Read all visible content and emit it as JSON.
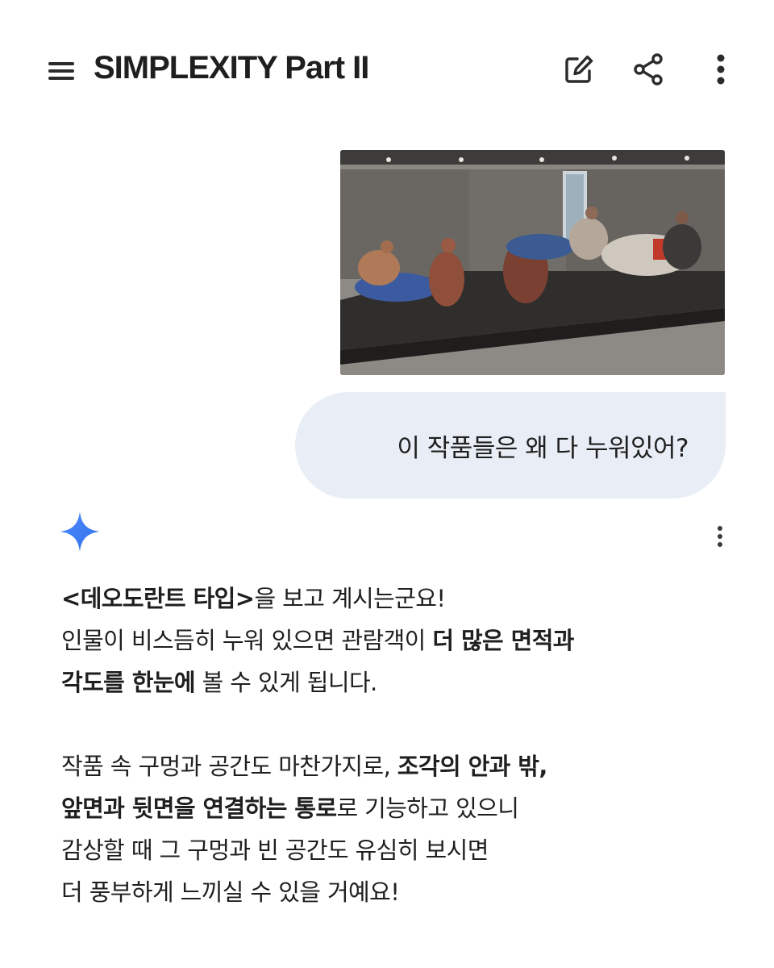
{
  "header": {
    "title": "SIMPLEXITY Part II",
    "icons": [
      "hamburger-menu-icon",
      "edit-icon",
      "share-icon",
      "more-vert-icon"
    ]
  },
  "user_message": {
    "text": "이 작품들은 왜 다 누워있어?",
    "bubble_color": "#e9eef6"
  },
  "response": {
    "icon": "gemini-sparkle-icon",
    "accent_color": "#4a86ff",
    "p1_l1_bold": "<데오도란트 타입>",
    "p1_l1_text": "을 보고 계시는군요!",
    "p1_l2_text": "인물이 비스듬히 누워 있으면 관람객이 ",
    "p1_l2_bold": "더 많은 면적과",
    "p1_l3_bold": "각도를 한눈에",
    "p1_l3_text": " 볼 수 있게 됩니다.",
    "p2_l1_text": "작품 속 구멍과 공간도 마찬가지로, ",
    "p2_l1_bold": "조각의 안과 밖,",
    "p2_l2_bold": "앞면과 뒷면을 연결하는 통로",
    "p2_l2_text": "로 기능하고 있으니",
    "p2_l3_text": "감상할 때 그 구멍과 빈 공간도 유심히 보시면",
    "p2_l4_text": "더 풍부하게 느끼실 수 있을 거예요!"
  }
}
